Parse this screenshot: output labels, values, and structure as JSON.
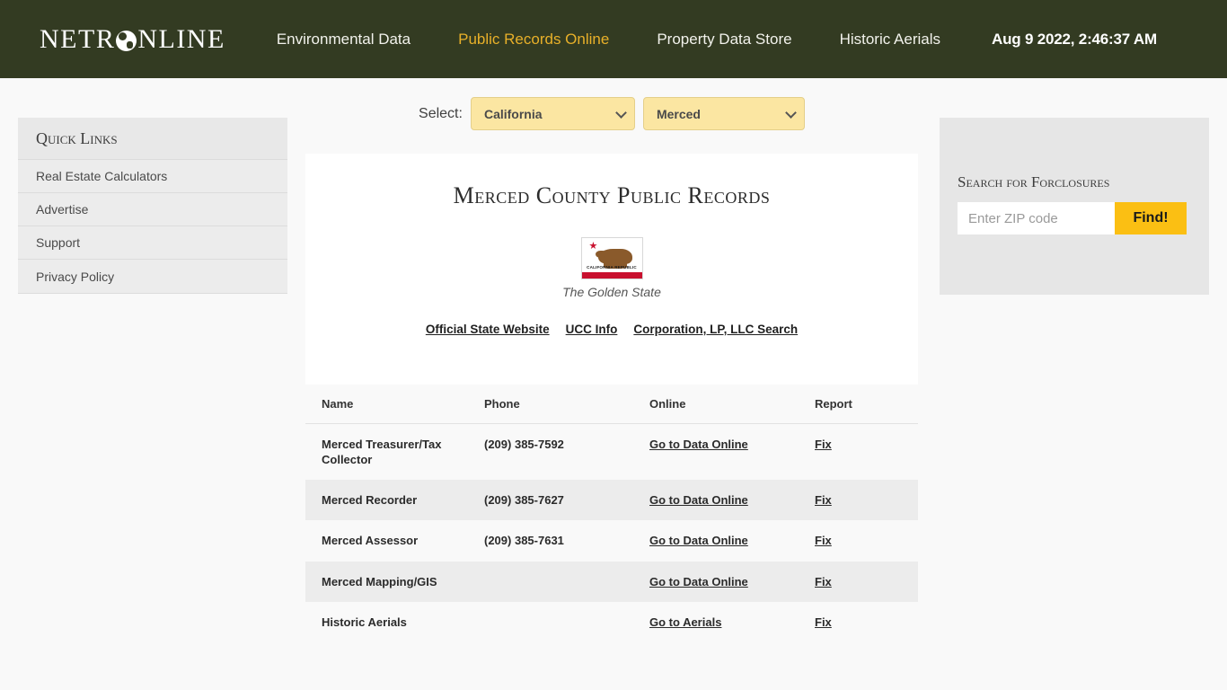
{
  "header": {
    "logo_text_before": "NETR",
    "logo_icon": "globe-icon",
    "logo_text_after": "NLINE",
    "nav": [
      {
        "label": "Environmental Data",
        "active": false
      },
      {
        "label": "Public Records Online",
        "active": true
      },
      {
        "label": "Property Data Store",
        "active": false
      },
      {
        "label": "Historic Aerials",
        "active": false
      }
    ],
    "clock": "Aug 9 2022, 2:46:37 AM",
    "bg_color": "#333b22",
    "active_link_color": "#e8b029"
  },
  "sidebar": {
    "title": "Quick Links",
    "items": [
      {
        "label": "Real Estate Calculators"
      },
      {
        "label": "Advertise"
      },
      {
        "label": "Support"
      },
      {
        "label": "Privacy Policy"
      }
    ]
  },
  "select_bar": {
    "label": "Select:",
    "state": {
      "value": "California",
      "options": [
        "California"
      ]
    },
    "county": {
      "value": "Merced",
      "options": [
        "Merced"
      ]
    },
    "bg_color": "#fbe6a2"
  },
  "main": {
    "title": "Merced County Public Records",
    "flag": {
      "alt": "california-state-flag",
      "republic_text": "CALIFORNIA REPUBLIC",
      "star": "★"
    },
    "flag_caption": "The Golden State",
    "state_links": [
      {
        "label": "Official State Website"
      },
      {
        "label": "UCC Info"
      },
      {
        "label": "Corporation, LP, LLC Search"
      }
    ]
  },
  "table": {
    "columns": [
      "Name",
      "Phone",
      "Online",
      "Report"
    ],
    "rows": [
      {
        "name": "Merced Treasurer/Tax Collector",
        "phone": "(209) 385-7592",
        "online": "Go to Data Online",
        "report": "Fix"
      },
      {
        "name": "Merced Recorder",
        "phone": "(209) 385-7627",
        "online": "Go to Data Online",
        "report": "Fix"
      },
      {
        "name": "Merced Assessor",
        "phone": "(209) 385-7631",
        "online": "Go to Data Online",
        "report": "Fix"
      },
      {
        "name": "Merced Mapping/GIS",
        "phone": "",
        "online": "Go to Data Online",
        "report": "Fix"
      },
      {
        "name": "Historic Aerials",
        "phone": "",
        "online": "Go to Aerials",
        "report": "Fix"
      }
    ]
  },
  "foreclosure": {
    "title": "Search for Forclosures",
    "placeholder": "Enter ZIP code",
    "input_value": "",
    "button_label": "Find!",
    "button_color": "#fbbf13"
  }
}
